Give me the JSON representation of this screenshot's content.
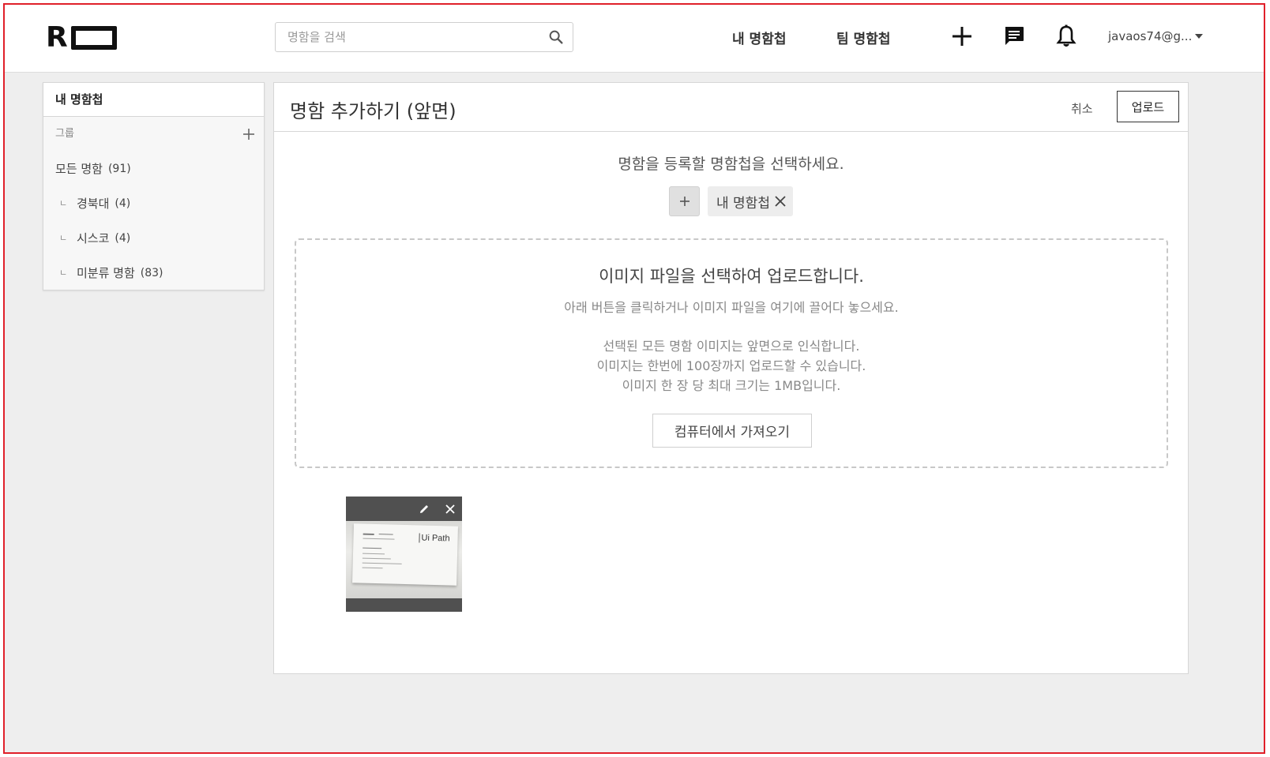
{
  "header": {
    "logo_letter": "R",
    "search_placeholder": "명함을 검색",
    "nav": [
      "내 명함첩",
      "팀 명함첩"
    ],
    "user": "javaos74@g..."
  },
  "sidebar": {
    "title": "내 명함첩",
    "group_label": "그룹",
    "items": [
      {
        "label": "모든 명함",
        "count": "(91)"
      },
      {
        "tree": "ㄴ",
        "label": "경북대",
        "count": "(4)"
      },
      {
        "tree": "ㄴ",
        "label": "시스코",
        "count": "(4)"
      },
      {
        "tree": "ㄴ",
        "label": "미분류 명함",
        "count": "(83)"
      }
    ]
  },
  "panel": {
    "title": "명함 추가하기 (앞면)",
    "cancel": "취소",
    "upload": "업로드",
    "choose_label": "명함을 등록할 명함첩을 선택하세요.",
    "selected_folder": "내 명함첩",
    "dropzone": {
      "title": "이미지 파일을 선택하여 업로드합니다.",
      "subtitle": "아래 버튼을 클릭하거나 이미지 파일을 여기에 끌어다 놓으세요.",
      "info": [
        "선택된 모든 명함 이미지는 앞면으로 인식합니다.",
        "이미지는 한번에 100장까지 업로드할 수 있습니다.",
        "이미지 한 장 당 최대 크기는 1MB입니다."
      ],
      "button": "컴퓨터에서 가져오기"
    },
    "thumbnail": {
      "card_brand": "Ui Path"
    }
  },
  "colors": {
    "frame_border": "#e0202a",
    "background": "#eeeeee",
    "thumb_bar": "#505050"
  }
}
